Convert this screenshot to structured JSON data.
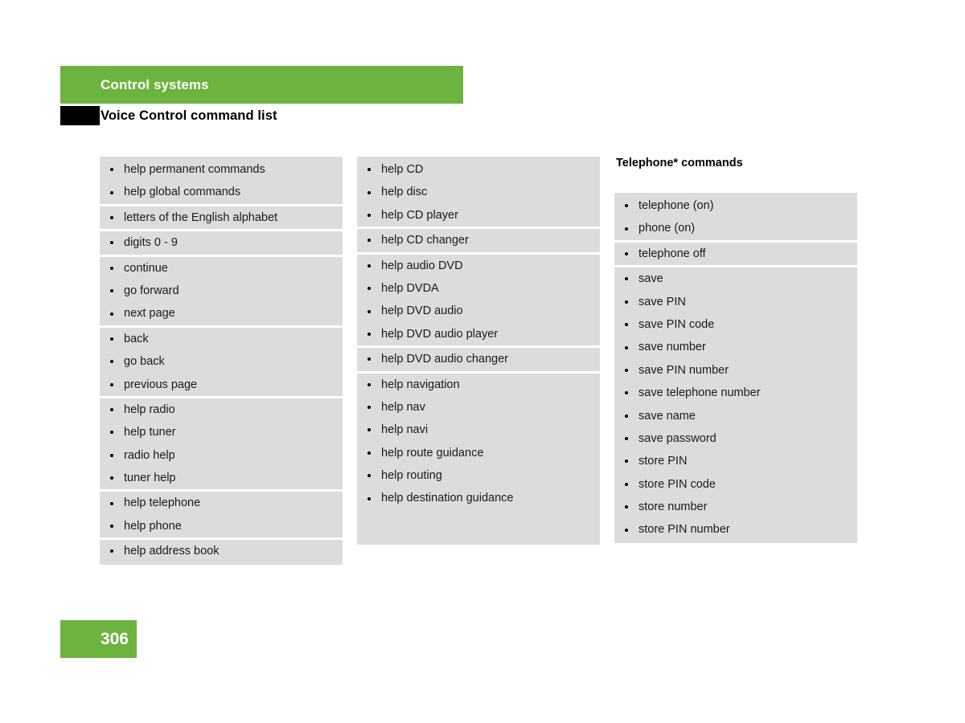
{
  "header": {
    "band_title": "Control systems",
    "subtitle": "Voice Control command list",
    "band_color": "#6db33f",
    "marker_color": "#000000"
  },
  "columns": [
    {
      "id": "column-1",
      "heading": "",
      "groups": [
        {
          "items": [
            "help permanent commands",
            "help global commands"
          ]
        },
        {
          "items": [
            "letters of the English alphabet"
          ]
        },
        {
          "items": [
            "digits 0 - 9"
          ]
        },
        {
          "items": [
            "continue",
            "go forward",
            "next page"
          ]
        },
        {
          "items": [
            "back",
            "go back",
            "previous page"
          ]
        },
        {
          "items": [
            "help radio",
            "help tuner",
            "radio help",
            "tuner help"
          ]
        },
        {
          "items": [
            "help telephone",
            "help phone"
          ]
        },
        {
          "items": [
            "help address book"
          ]
        }
      ]
    },
    {
      "id": "column-2",
      "heading": "",
      "groups": [
        {
          "items": [
            "help CD",
            "help disc",
            "help CD player"
          ]
        },
        {
          "items": [
            "help CD changer"
          ]
        },
        {
          "items": [
            "help audio DVD",
            "help DVDA",
            "help DVD audio",
            "help DVD audio player"
          ]
        },
        {
          "items": [
            "help DVD audio changer"
          ]
        },
        {
          "items": [
            "help navigation",
            "help nav",
            "help navi",
            "help route guidance",
            "help routing",
            "help destination guidance"
          ]
        }
      ]
    },
    {
      "id": "column-3",
      "heading": "Telephone* commands",
      "groups": [
        {
          "items": [
            "telephone (on)",
            "phone (on)"
          ]
        },
        {
          "items": [
            "telephone off"
          ]
        },
        {
          "items": [
            "save",
            "save PIN",
            "save PIN code",
            "save number",
            "save PIN number",
            "save telephone number",
            "save name",
            "save password",
            "store PIN",
            "store PIN code",
            "store number",
            "store PIN number"
          ]
        }
      ]
    }
  ],
  "footer": {
    "page_number": "306",
    "band_color": "#6db33f"
  },
  "palette": {
    "list_background": "#dcdcdc",
    "separator": "#ffffff",
    "text": "#1a1a1a",
    "page_background": "#ffffff"
  }
}
